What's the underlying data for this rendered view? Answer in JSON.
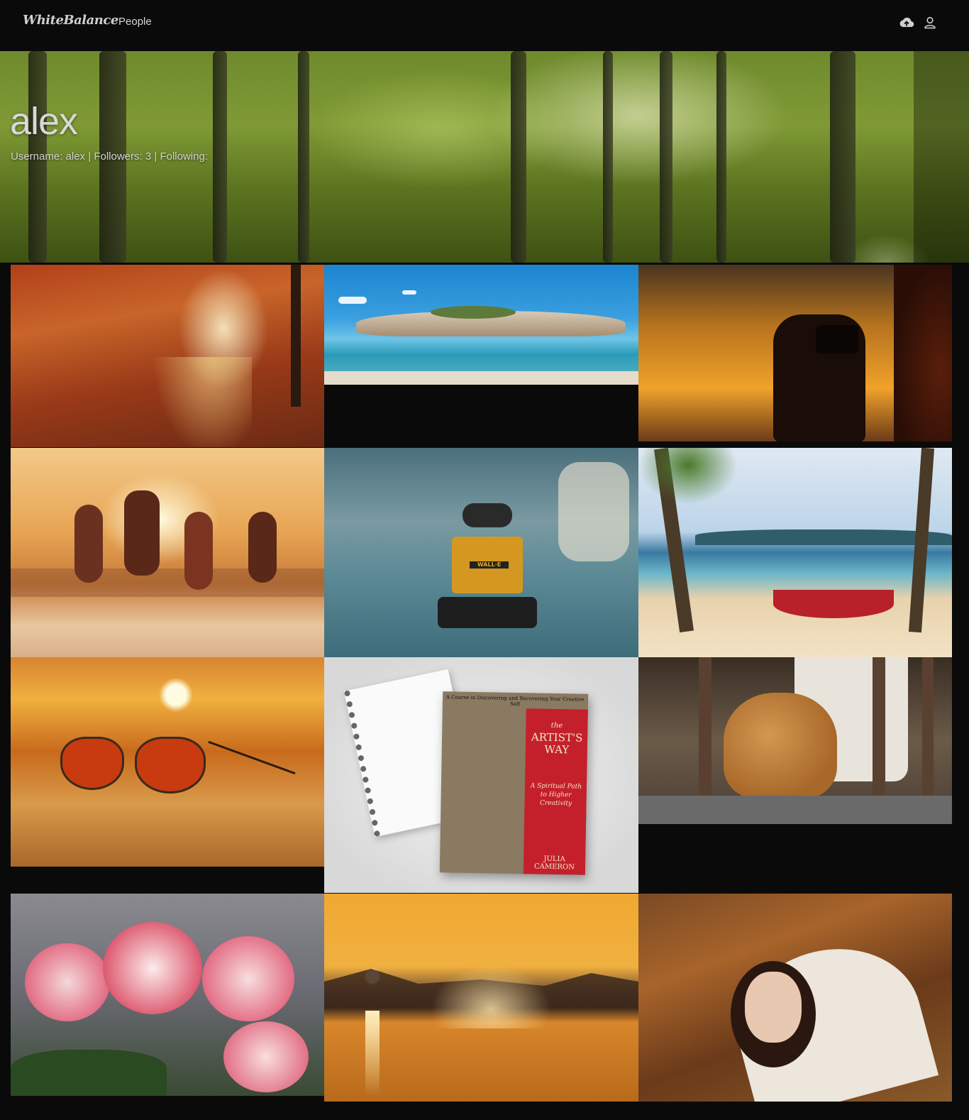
{
  "nav": {
    "logo": "WhiteBalance",
    "link_people": "People",
    "upload_icon": "cloud-upload-icon",
    "user_icon": "user-icon"
  },
  "profile": {
    "name": "alex",
    "meta_username_label": "Username:",
    "username": "alex",
    "sep1": "|",
    "followers_label": "Followers:",
    "followers": "3",
    "sep2": "|",
    "following_label": "Following:"
  },
  "photos": [
    "autumn-forest-path",
    "rocky-island",
    "phone-sunset",
    "beach-jump",
    "wall-e",
    "palm-hammock",
    "sunglasses-sunset",
    "artists-way-book",
    "ginger-cat",
    "roses",
    "water-splash-sunset",
    "woman-in-leaves"
  ],
  "book": {
    "tagline": "A Course in Discovering and Recovering Your Creative Self",
    "title_the": "the",
    "title_main": "ARTIST'S WAY",
    "subtitle": "A Spiritual Path to Higher Creativity",
    "author": "JULIA CAMERON"
  },
  "walle_label": "WALL·E",
  "colors": {
    "background": "#0a0a0b",
    "nav_text": "#d7d7d7"
  }
}
